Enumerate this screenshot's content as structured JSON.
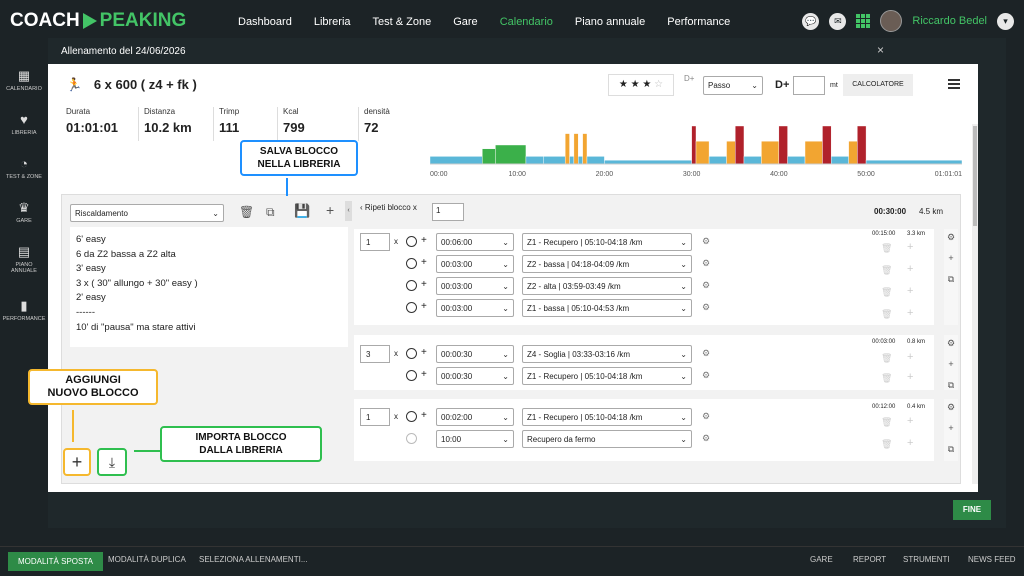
{
  "logo": {
    "left": "COACH",
    "right": "PEAKING"
  },
  "nav": {
    "items": [
      "Dashboard",
      "Libreria",
      "Test & Zone",
      "Gare",
      "Calendario",
      "Piano annuale",
      "Performance"
    ],
    "active": "Calendario"
  },
  "user": {
    "name": "Riccardo Bedel"
  },
  "sidebar": {
    "items": [
      "CALENDARIO",
      "LIBRERIA",
      "TEST & ZONE",
      "GARE",
      "PIANO ANNUALE",
      "PERFORMANCE"
    ]
  },
  "modal": {
    "title": "Allenamento del 24/06/2026",
    "close": "×",
    "finish": "FINE"
  },
  "workout": {
    "title": "6 x 600 ( z4 + fk )",
    "rating_stars": 3,
    "rating_max": 5,
    "dplus_small": "D+",
    "pace_select": "Passo",
    "dplus_label": "D+",
    "dplus_unit": "mt",
    "calc_button": "CALCOLATORE",
    "stats": [
      {
        "label": "Durata",
        "value": "01:01:01"
      },
      {
        "label": "Distanza",
        "value": "10.2 km"
      },
      {
        "label": "Trimp",
        "value": "111"
      },
      {
        "label": "Kcal",
        "value": "799"
      },
      {
        "label": "densità",
        "value": "72"
      }
    ]
  },
  "chart_data": {
    "type": "bar",
    "x_ticks": [
      "00:00",
      "10:00",
      "20:00",
      "30:00",
      "40:00",
      "50:00",
      "01:01:01"
    ],
    "series": [
      {
        "segments": [
          {
            "start_min": 0,
            "end_min": 6,
            "zone": 1
          },
          {
            "start_min": 6,
            "end_min": 7.5,
            "zone": 2
          },
          {
            "start_min": 7.5,
            "end_min": 11,
            "zone": 2.5
          },
          {
            "start_min": 11,
            "end_min": 13,
            "zone": 1
          },
          {
            "start_min": 13,
            "end_min": 15.5,
            "zone": 1
          },
          {
            "start_min": 15.5,
            "end_min": 16,
            "zone": 4
          },
          {
            "start_min": 16,
            "end_min": 16.5,
            "zone": 1
          },
          {
            "start_min": 16.5,
            "end_min": 17,
            "zone": 4
          },
          {
            "start_min": 17,
            "end_min": 17.5,
            "zone": 1
          },
          {
            "start_min": 17.5,
            "end_min": 18,
            "zone": 4
          },
          {
            "start_min": 18,
            "end_min": 20,
            "zone": 1
          },
          {
            "start_min": 20,
            "end_min": 30,
            "zone": 0.5
          },
          {
            "start_min": 30,
            "end_min": 30.5,
            "zone": 5
          },
          {
            "start_min": 30.5,
            "end_min": 32,
            "zone": 3
          },
          {
            "start_min": 32,
            "end_min": 34,
            "zone": 1
          },
          {
            "start_min": 34,
            "end_min": 35,
            "zone": 3
          },
          {
            "start_min": 35,
            "end_min": 36,
            "zone": 5
          },
          {
            "start_min": 36,
            "end_min": 38,
            "zone": 1
          },
          {
            "start_min": 38,
            "end_min": 40,
            "zone": 3
          },
          {
            "start_min": 40,
            "end_min": 41,
            "zone": 5
          },
          {
            "start_min": 41,
            "end_min": 43,
            "zone": 1
          },
          {
            "start_min": 43,
            "end_min": 45,
            "zone": 3
          },
          {
            "start_min": 45,
            "end_min": 46,
            "zone": 5
          },
          {
            "start_min": 46,
            "end_min": 48,
            "zone": 1
          },
          {
            "start_min": 48,
            "end_min": 49,
            "zone": 3
          },
          {
            "start_min": 49,
            "end_min": 50,
            "zone": 5
          },
          {
            "start_min": 50,
            "end_min": 61,
            "zone": 0.5
          }
        ]
      }
    ],
    "colors": {
      "0.5": "#5ab7d8",
      "1": "#5ab7d8",
      "2": "#3bb04a",
      "2.5": "#3bb04a",
      "3": "#f2a531",
      "4": "#f2a531",
      "5": "#b0212b"
    }
  },
  "editor": {
    "block_type": "Riscaldamento",
    "repeat_label": "Ripeti blocco x",
    "repeat_value": "1",
    "total_time": "00:30:00",
    "total_dist": "4.5 km",
    "notes": [
      "6' easy",
      "6 da Z2 bassa a Z2 alta",
      "3' easy",
      "3 x ( 30\" allungo + 30\" easy )",
      "2' easy",
      "------",
      "10' di \"pausa\" ma stare attivi"
    ],
    "blocks": [
      {
        "reps": "1",
        "time": "00:15:00",
        "dist": "3.3 km",
        "rows": [
          {
            "time": "00:06:00",
            "zone": "Z1 - Recupero | 05:10-04:18 /km"
          },
          {
            "time": "00:03:00",
            "zone": "Z2 - bassa | 04:18-04:09 /km"
          },
          {
            "time": "00:03:00",
            "zone": "Z2 - alta | 03:59-03:49 /km"
          },
          {
            "time": "00:03:00",
            "zone": "Z1 - bassa | 05:10-04:53 /km"
          }
        ]
      },
      {
        "reps": "3",
        "time": "00:03:00",
        "dist": "0.8 km",
        "rows": [
          {
            "time": "00:00:30",
            "zone": "Z4 - Soglia | 03:33-03:16 /km"
          },
          {
            "time": "00:00:30",
            "zone": "Z1 - Recupero | 05:10-04:18 /km"
          }
        ]
      },
      {
        "reps": "1",
        "time": "00:12:00",
        "dist": "0.4 km",
        "rows": [
          {
            "time": "00:02:00",
            "zone": "Z1 - Recupero | 05:10-04:18 /km"
          },
          {
            "time": "10:00",
            "zone": "Recupero da fermo"
          }
        ]
      }
    ]
  },
  "callouts": {
    "save": "SALVA BLOCCO\nNELLA LIBRERIA",
    "add": "AGGIUNGI\nNUOVO BLOCCO",
    "import": "IMPORTA BLOCCO\nDALLA LIBRERIA"
  },
  "bottombar": {
    "left": [
      "MODALITÀ SPOSTA",
      "MODALITÀ DUPLICA",
      "SELEZIONA ALLENAMENTI..."
    ],
    "right": [
      "GARE",
      "REPORT",
      "STRUMENTI",
      "NEWS FEED"
    ]
  }
}
